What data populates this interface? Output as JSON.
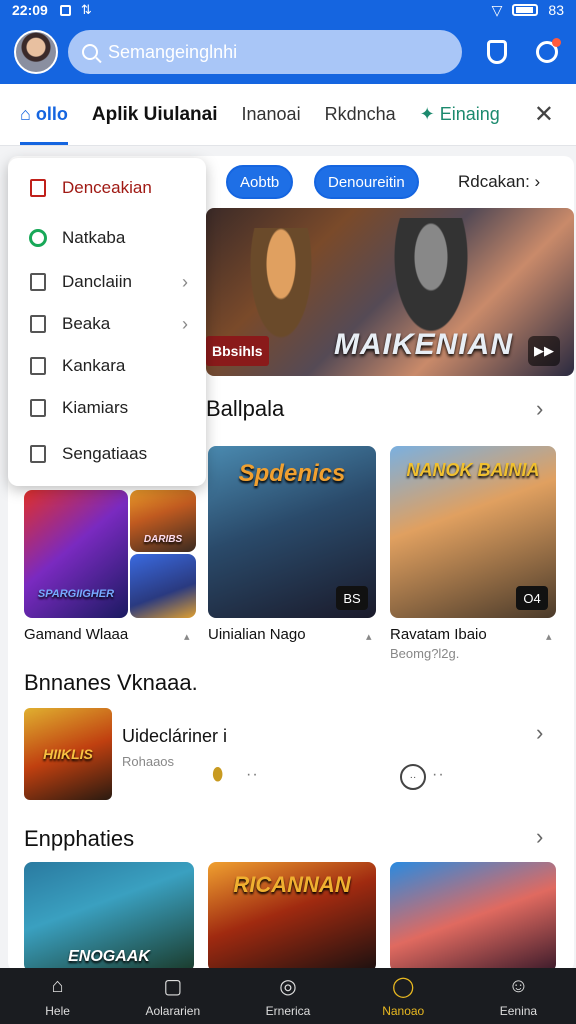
{
  "status": {
    "time": "22:09",
    "right_text": "83"
  },
  "header": {
    "search_placeholder": "Semangeinglnhi",
    "avatar": "user-avatar",
    "icons": [
      "shield-icon",
      "gear-icon"
    ]
  },
  "tabs": [
    {
      "label": "ollo"
    },
    {
      "label": "Aplik Uiulanai"
    },
    {
      "label": "Inanoai"
    },
    {
      "label": "Rkdncha"
    },
    {
      "label": "Einaing"
    }
  ],
  "chips": [
    {
      "label": "Aobtb"
    },
    {
      "label": "Denoureitin"
    }
  ],
  "chip_more": "Rdcakan:",
  "banner": {
    "title": "MAIKENIAN",
    "tag": "Bbsihls",
    "button": "▶▶"
  },
  "menu": [
    {
      "label": "Denceakian",
      "icon": "document-red-icon"
    },
    {
      "label": "Natkaba",
      "icon": "circle-green-icon"
    },
    {
      "label": "Danclaiin",
      "icon": "list-icon",
      "chevron": true
    },
    {
      "label": "Beaka",
      "icon": "book-icon",
      "chevron": true
    },
    {
      "label": "Kankara",
      "icon": "store-icon"
    },
    {
      "label": "Kiamiars",
      "icon": "card-icon"
    },
    {
      "label": "Sengatiaas",
      "icon": "settings-icon"
    }
  ],
  "section1": {
    "title": "Ballpala",
    "tiles": [
      {
        "name": "Gamand Wlaaa",
        "art_text": "SPARGIIGHER",
        "badge": ""
      },
      {
        "name": "Uinialian Nago",
        "art_text": "Spdenics",
        "badge": "BS"
      },
      {
        "name": "Ravatam Ibaio",
        "sub": "Beomg?l2g.",
        "art_text": "NANOK BAINIA",
        "badge": "O4"
      }
    ],
    "tile_small": {
      "art_text": "DARIBS"
    }
  },
  "section2": {
    "title": "Bnnanes Vknaaa.",
    "row": {
      "title": "Uidecláriner i",
      "sub": "Rohaaos",
      "thumb_text": "HIIKLIS"
    }
  },
  "section3": {
    "title": "Enpphaties",
    "tiles": [
      {
        "art_text": "ENOGAAK"
      },
      {
        "art_text": "RICANNAN"
      },
      {
        "art_text": ""
      }
    ]
  },
  "bottom_nav": [
    {
      "label": "Hele",
      "icon": "home-icon"
    },
    {
      "label": "Aolararien",
      "icon": "message-icon"
    },
    {
      "label": "Ernerica",
      "icon": "compass-icon"
    },
    {
      "label": "Nanoao",
      "icon": "search-icon",
      "active": true
    },
    {
      "label": "Eenina",
      "icon": "profile-icon"
    }
  ],
  "colors": {
    "primary": "#1565e0",
    "active_nav": "#e8b820",
    "bottom_bg": "#1a1c20"
  }
}
